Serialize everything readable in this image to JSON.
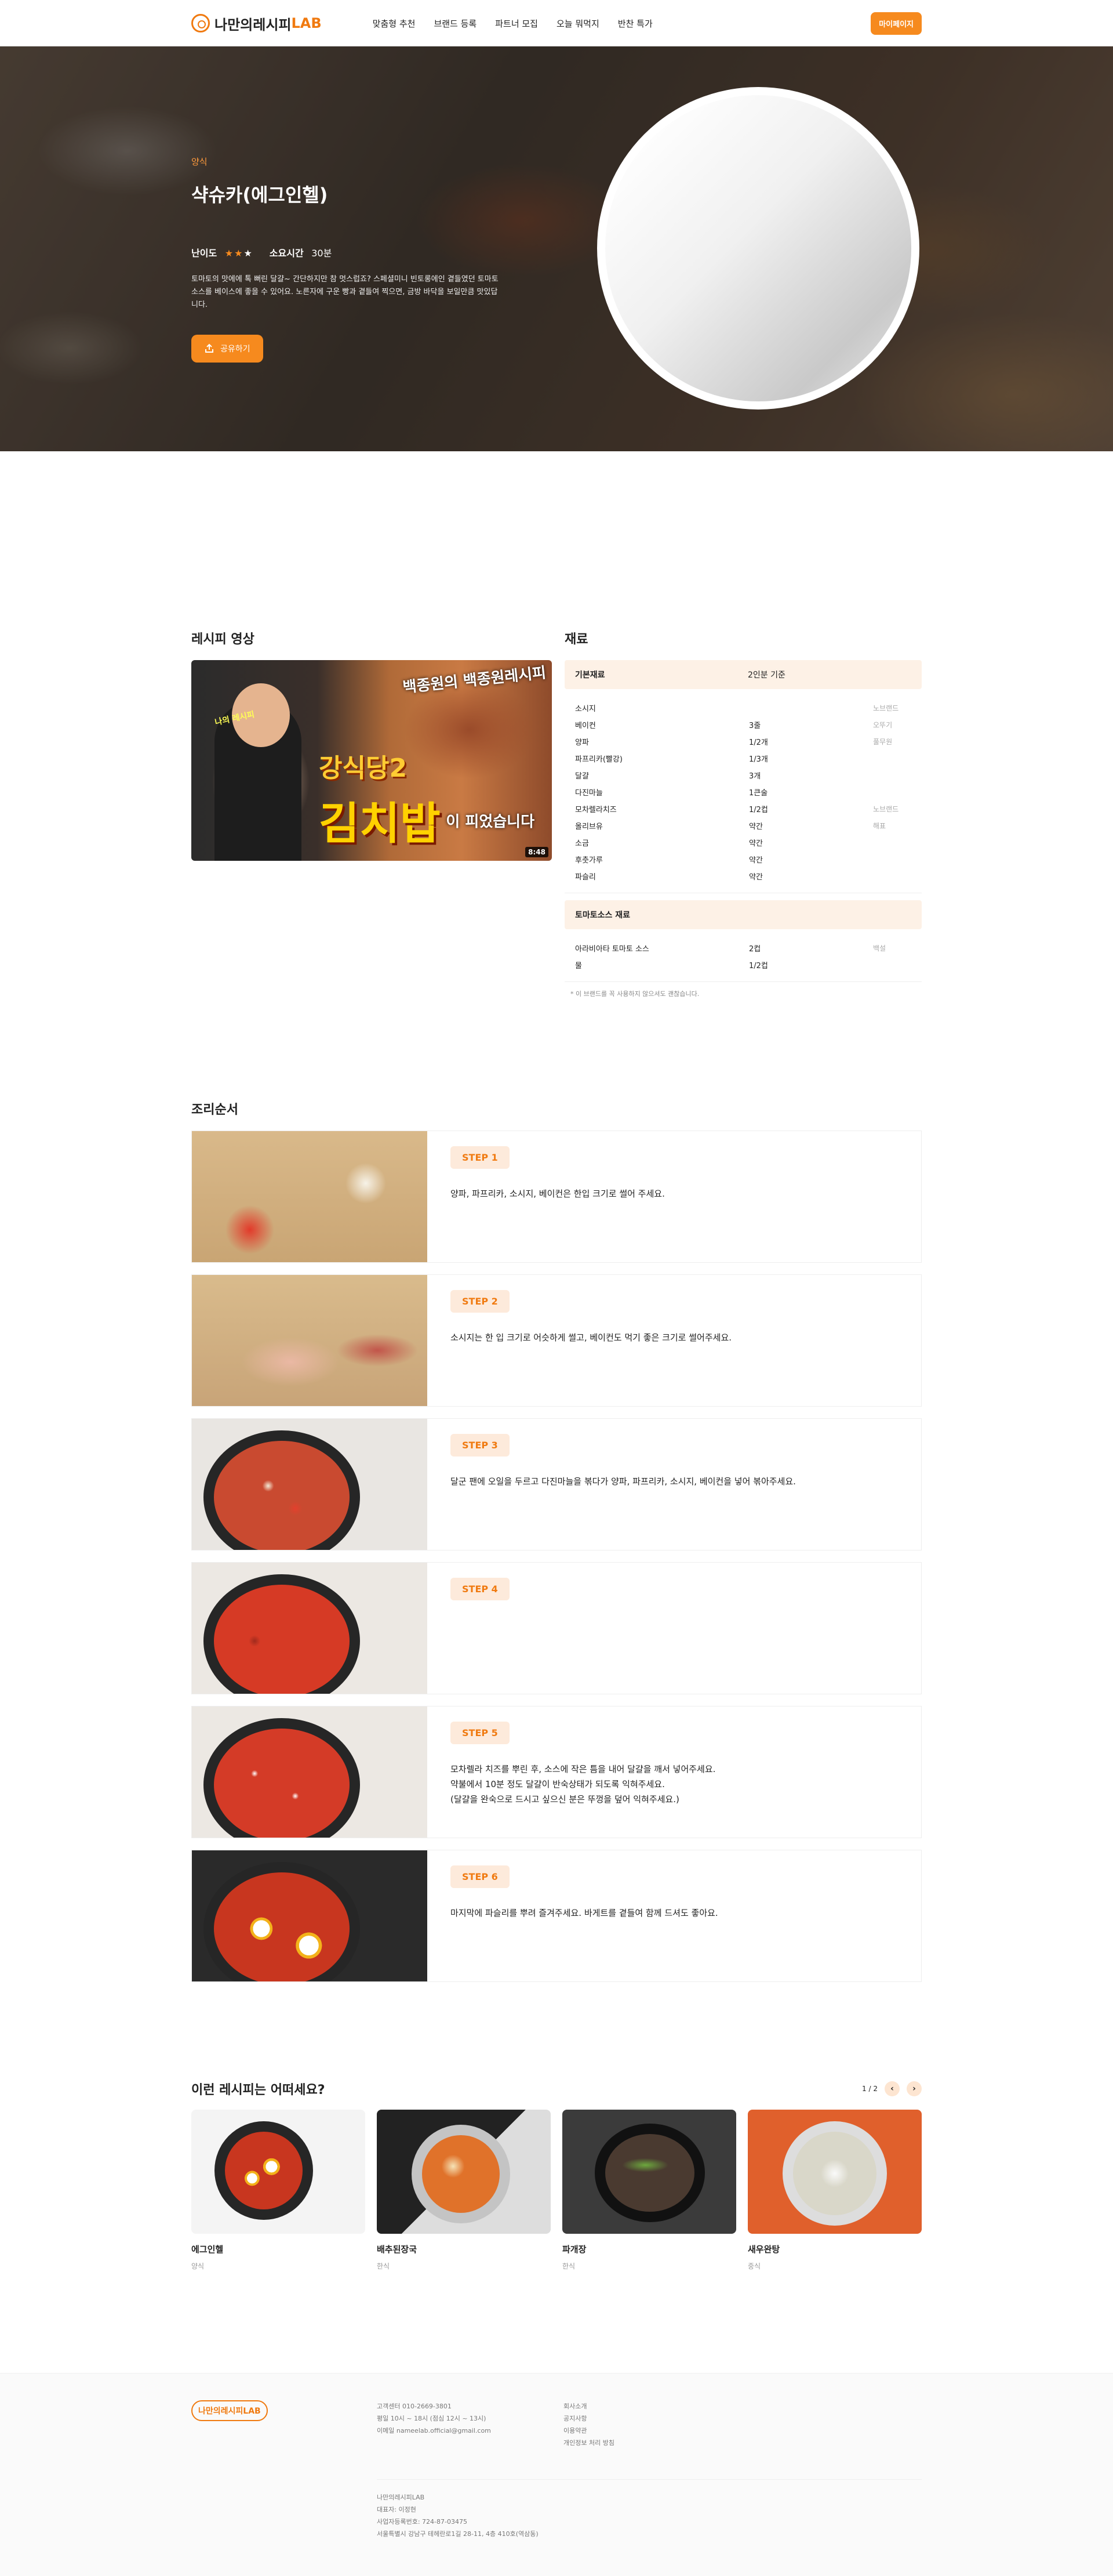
{
  "header": {
    "logo_main": "나만의레시피",
    "logo_lab": "LAB",
    "nav": [
      "맞춤형 추천",
      "브랜드 등록",
      "파트너 모집",
      "오늘 뭐먹지",
      "반찬 특가"
    ],
    "mypage": "마이페이지",
    "accent": "#f68a1e"
  },
  "hero": {
    "category": "양식",
    "title": "샥슈카(에그인헬)",
    "difficulty_label": "난이도",
    "difficulty_stars": 2,
    "difficulty_max": 3,
    "time_label": "소요시간",
    "time_value": "30분",
    "description": "토마토의 맛에에 톡 뻐린 달걀~ 간단하지만 참 멋스럽죠? 스페셜미니 빈토롱에인 곁들였던 토마토소스를 베이스에 좋을 수 있어요. 노른자에 구운 빵과 곁들여 찍으면, 금방 바닥을 보일만큼 맛있답니다.",
    "share": "공유하기"
  },
  "video": {
    "section_title": "레시피 영상",
    "text_top": "백종원의 백종원레시피",
    "text_small": "나의 레시피",
    "text_mid": "강식당2",
    "text_big": "김치밥",
    "text_tail": "이 피었습니다",
    "duration": "8:48"
  },
  "ingredients": {
    "section_title": "재료",
    "head_left": "기본재료",
    "head_right": "2인분 기준",
    "items": [
      {
        "name": "소시지",
        "qty": "",
        "brand": "노브랜드"
      },
      {
        "name": "베이컨",
        "qty": "3줄",
        "brand": "오뚜기"
      },
      {
        "name": "양파",
        "qty": "1/2개",
        "brand": "풀무원"
      },
      {
        "name": "파프리카(빨강)",
        "qty": "1/3개",
        "brand": ""
      },
      {
        "name": "달걀",
        "qty": "3개",
        "brand": ""
      },
      {
        "name": "다진마늘",
        "qty": "1큰술",
        "brand": ""
      },
      {
        "name": "모차렐라치즈",
        "qty": "1/2컵",
        "brand": "노브랜드"
      },
      {
        "name": "올리브유",
        "qty": "약간",
        "brand": "해표"
      },
      {
        "name": "소금",
        "qty": "약간",
        "brand": ""
      },
      {
        "name": "후춧가루",
        "qty": "약간",
        "brand": ""
      },
      {
        "name": "파슬리",
        "qty": "약간",
        "brand": ""
      }
    ],
    "sauce_title": "토마토소스 재료",
    "sauce_items": [
      {
        "name": "아라비아타 토마토 소스",
        "qty": "2컵",
        "brand": "백설"
      },
      {
        "name": "물",
        "qty": "1/2컵",
        "brand": ""
      }
    ],
    "note": "* 이 브랜드를 꼭 사용하지 않으셔도 괜찮습니다."
  },
  "steps": {
    "section_title": "조리순서",
    "items": [
      {
        "badge": "STEP 1",
        "text": "양파, 파프리카, 소시지, 베이컨은 한입 크기로 썰어 주세요."
      },
      {
        "badge": "STEP 2",
        "text": "소시지는 한 입 크기로 어슷하게 썰고, 베이컨도 먹기 좋은 크기로 썰어주세요."
      },
      {
        "badge": "STEP 3",
        "text": "달군 팬에 오일을 두르고 다진마늘을 볶다가 양파, 파프리카, 소시지, 베이컨을 넣어 볶아주세요."
      },
      {
        "badge": "STEP 4",
        "text": ""
      },
      {
        "badge": "STEP 5",
        "text": "모차렐라 치즈를 뿌린 후, 소스에 작은 틈을 내어 달걀을 깨서 넣어주세요.\n약불에서 10분 정도 달걀이 반숙상태가 되도록 익혀주세요.\n(달걀을 완숙으로 드시고 싶으신 분은 뚜껑을 덮어 익혀주세요.)"
      },
      {
        "badge": "STEP 6",
        "text": "마지막에 파슬리를 뿌려 즐겨주세요. 바게트를 곁들여 함께 드셔도 좋아요."
      }
    ]
  },
  "recommend": {
    "section_title": "이런 레시피는 어떠세요?",
    "page": "1 / 2",
    "prev": "‹",
    "next": "›",
    "cards": [
      {
        "name": "에그인헬",
        "category": "양식"
      },
      {
        "name": "배추된장국",
        "category": "한식"
      },
      {
        "name": "파개장",
        "category": "한식"
      },
      {
        "name": "새우완탕",
        "category": "중식"
      }
    ]
  },
  "footer": {
    "logo": "나만의레시피LAB",
    "contact": [
      "고객센터 010-2669-3801",
      "평일 10시 ~ 18시 (점심 12시 ~ 13시)",
      "이메일 nameelab.official@gmail.com"
    ],
    "links": [
      "회사소개",
      "공지사항",
      "이용약관",
      "개인정보 처리 방침"
    ],
    "company": [
      "나만의레시피LAB",
      "대표자: 이정현",
      "사업자등록번호: 724-87-03475",
      "서울특별시 강남구 테헤란로1길 28-11, 4층 410호(역삼동)"
    ]
  }
}
